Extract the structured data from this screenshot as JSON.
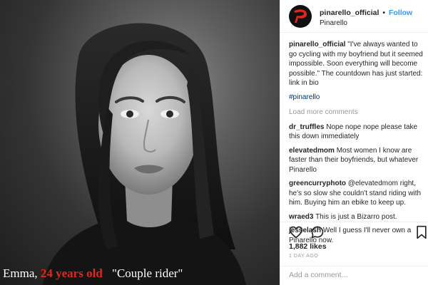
{
  "post": {
    "caption_overlay": {
      "name": "Emma,",
      "age": "24 years old",
      "quote": "\"Couple rider\""
    }
  },
  "header": {
    "username": "pinarello_official",
    "separator": "•",
    "follow_label": "Follow",
    "subtitle": "Pinarello"
  },
  "caption": {
    "username": "pinarello_official",
    "text": "\"I've always wanted to go cycling with my boyfriend but it seemed impossible. Soon everything will become possible.\" The countdown has just started: link in bio",
    "hashtag": "#pinarello"
  },
  "load_more_label": "Load more comments",
  "comments": [
    {
      "username": "dr_truffles",
      "text": "Nope nope nope please take this down immediately"
    },
    {
      "username": "elevatedmom",
      "text": "Most women I know are faster than their boyfriends, but whatever Pinarello"
    },
    {
      "username": "greencurryphoto",
      "text": "@elevatedmom right, he's so slow she couldn't stand riding with him. Buying him an ebike to keep up."
    },
    {
      "username": "wraed3",
      "text": "This is just a Bizarro post."
    },
    {
      "username": "jesselash",
      "text": "Well I guess I'll never own a Pinarello now."
    }
  ],
  "actions": {
    "like_icon": "heart-icon",
    "comment_icon": "comment-icon",
    "save_icon": "bookmark-icon"
  },
  "likes": "1,882 likes",
  "posted": "1 DAY AGO",
  "add_comment_placeholder": "Add a comment...",
  "colors": {
    "accent_red": "#e0271d",
    "follow_blue": "#3897f0",
    "hashtag_blue": "#003569",
    "muted_gray": "#999999"
  }
}
